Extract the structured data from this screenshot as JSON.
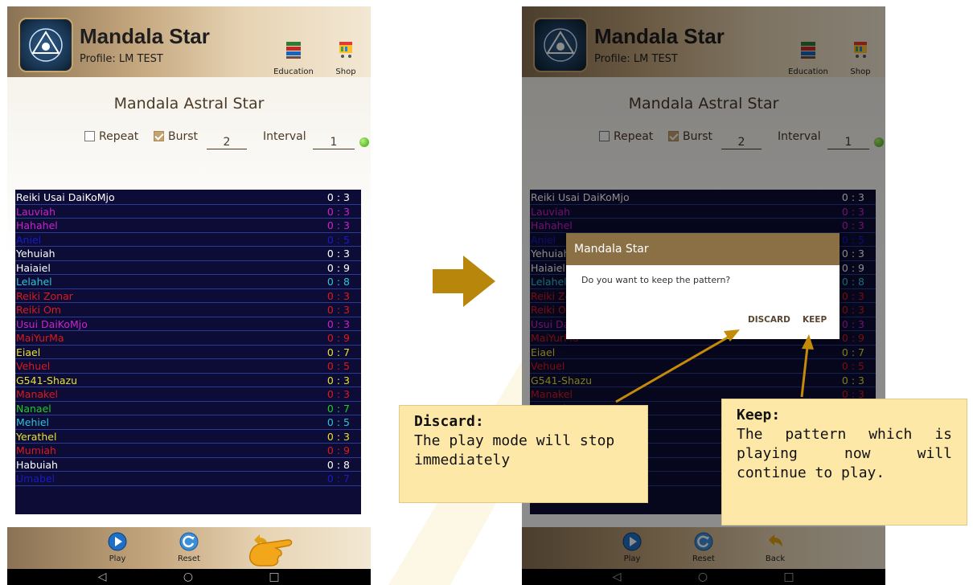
{
  "app": {
    "title": "Mandala Star",
    "profile": "Profile: LM TEST",
    "education_label": "Education",
    "shop_label": "Shop"
  },
  "screen": {
    "title": "Mandala Astral Star",
    "repeat_label": "Repeat",
    "repeat_checked": false,
    "burst_label": "Burst",
    "burst_checked": true,
    "burst_value": "2",
    "interval_label": "Interval",
    "interval_value": "1"
  },
  "entries": [
    {
      "name": "Reiki Usai DaiKoMjo",
      "value": "0 : 3",
      "color": "#ffffff"
    },
    {
      "name": "Lauviah",
      "value": "0 : 3",
      "color": "#cc22cc"
    },
    {
      "name": "Hahahel",
      "value": "0 : 3",
      "color": "#cc22cc"
    },
    {
      "name": "Aniel",
      "value": "0 : 5",
      "color": "#1a1acc"
    },
    {
      "name": "Yehuiah",
      "value": "0 : 3",
      "color": "#ffffff"
    },
    {
      "name": "Haiaiel",
      "value": "0 : 9",
      "color": "#ffffff"
    },
    {
      "name": "Lelahel",
      "value": "0 : 8",
      "color": "#2fc4d8"
    },
    {
      "name": "Reiki Zonar",
      "value": "0 : 3",
      "color": "#dd1a1a"
    },
    {
      "name": "Reiki Om",
      "value": "0 : 3",
      "color": "#dd1a1a"
    },
    {
      "name": "Usui DaiKoMjo",
      "value": "0 : 3",
      "color": "#cc22cc"
    },
    {
      "name": "MaiYurMa",
      "value": "0 : 9",
      "color": "#dd1a1a"
    },
    {
      "name": "Eiael",
      "value": "0 : 7",
      "color": "#e8e030"
    },
    {
      "name": "Vehuel",
      "value": "0 : 5",
      "color": "#dd1a1a"
    },
    {
      "name": "G541-Shazu",
      "value": "0 : 3",
      "color": "#e8e030"
    },
    {
      "name": "Manakel",
      "value": "0 : 3",
      "color": "#dd1a1a"
    },
    {
      "name": "Nanael",
      "value": "0 : 7",
      "color": "#22cc22"
    },
    {
      "name": "Mehiel",
      "value": "0 : 5",
      "color": "#2fc4d8"
    },
    {
      "name": "Yerathel",
      "value": "0 : 3",
      "color": "#e8e030"
    },
    {
      "name": "Mumiah",
      "value": "0 : 9",
      "color": "#dd1a1a"
    },
    {
      "name": "Habuiah",
      "value": "0 : 8",
      "color": "#ffffff"
    },
    {
      "name": "Umabel",
      "value": "0 : 7",
      "color": "#1a1acc"
    }
  ],
  "footer": {
    "play_label": "Play",
    "reset_label": "Reset",
    "back_label": "Back"
  },
  "navbar": {
    "back_glyph": "◁",
    "home_glyph": "○",
    "recents_glyph": "□"
  },
  "dialog": {
    "title": "Mandala Star",
    "message": "Do you want to keep the pattern?",
    "discard_label": "DISCARD",
    "keep_label": "KEEP"
  },
  "callouts": {
    "discard_title": "Discard",
    "discard_body": "The play mode will stop immediately",
    "keep_title": "Keep",
    "keep_body": "The pattern which is playing now will continue to play."
  },
  "colors": {
    "header_gold": "#c4a67d",
    "dialog_header": "#8b6f45",
    "list_background": "#0c0c36",
    "callout_background": "#fee8a8",
    "arrow_gold": "#c48a08"
  }
}
